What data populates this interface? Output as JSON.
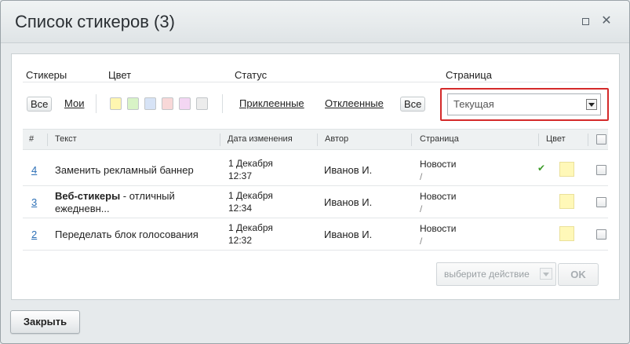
{
  "window": {
    "title": "Список стикеров (3)"
  },
  "filters": {
    "stickers_label": "Стикеры",
    "color_label": "Цвет",
    "status_label": "Статус",
    "page_label": "Страница",
    "all_label": "Все",
    "mine_label": "Мои",
    "status_all_label": "Все",
    "attached_label": "Приклеенные",
    "detached_label": "Отклеенные",
    "colors": [
      "#fff6b0",
      "#d8f3c6",
      "#d7e3f6",
      "#f8d8d8",
      "#f3d6f3",
      "#ececec"
    ],
    "page_select_value": "Текущая"
  },
  "table": {
    "headers": [
      "#",
      "Текст",
      "Дата изменения",
      "Автор",
      "Страница",
      "Цвет"
    ],
    "rows": [
      {
        "num": "4",
        "text_bold": "",
        "text": "Заменить рекламный баннер",
        "text2": "",
        "date1": "1 Декабря",
        "date2": "12:37",
        "author": "Иванов И.",
        "page": "Новости",
        "page_path": "/",
        "checked_mark": "✔",
        "color": "#fff8b8"
      },
      {
        "num": "3",
        "text_bold": "Веб-стикеры",
        "text": " - отличный",
        "text2": "ежедневн...",
        "date1": "1 Декабря",
        "date2": "12:34",
        "author": "Иванов И.",
        "page": "Новости",
        "page_path": "/",
        "checked_mark": "",
        "color": "#fff8b8"
      },
      {
        "num": "2",
        "text_bold": "",
        "text": "Переделать блок голосования",
        "text2": "",
        "date1": "1 Декабря",
        "date2": "12:32",
        "author": "Иванов И.",
        "page": "Новости",
        "page_path": "/",
        "checked_mark": "",
        "color": "#fff8b8"
      }
    ]
  },
  "actions": {
    "action_select_placeholder": "выберите действие",
    "ok_label": "OK",
    "close_label": "Закрыть"
  }
}
